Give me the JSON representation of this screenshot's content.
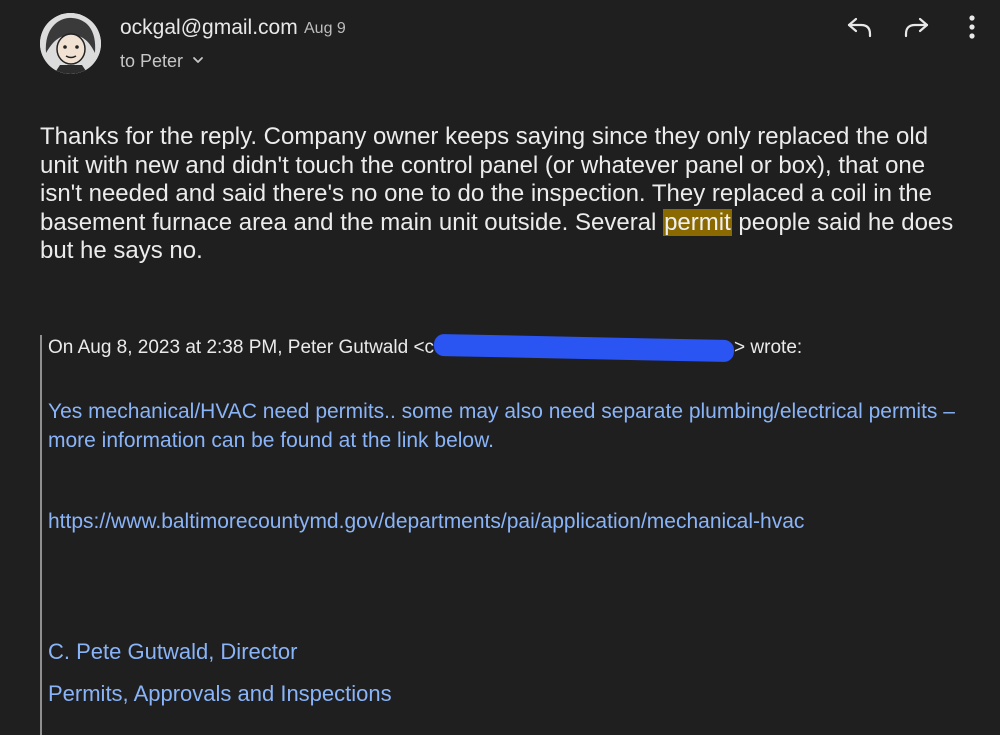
{
  "header": {
    "sender": "ockgal@gmail.com",
    "date": "Aug 9",
    "to_label": "to Peter",
    "icons": [
      "reply-icon",
      "forward-icon",
      "more-vert-icon",
      "chevron-down-icon"
    ]
  },
  "message": {
    "text_before": "Thanks for the reply. Company owner keeps saying since they only replaced the old unit with new and didn't touch the control panel (or whatever panel or box), that one isn't needed and said there's no one to do the inspection. They replaced a coil in the basement furnace area and the main unit outside. Several ",
    "highlight": "permit",
    "text_after": " people said he does but he says no."
  },
  "quote": {
    "header_prefix": "On Aug 8, 2023 at 2:38 PM, Peter Gutwald <",
    "header_partial": "c",
    "header_suffix": "> wrote:",
    "text": "Yes mechanical/HVAC need permits.. some may also need separate plumbing/electrical permits – more information can be found at the link below.",
    "link": "https://www.baltimorecountymd.gov/departments/pai/application/mechanical-hvac",
    "signature_name": "C. Pete Gutwald, Director",
    "signature_dept": "Permits, Approvals and Inspections"
  },
  "colors": {
    "background": "#1f1f1f",
    "quote_text": "#8ab4f8",
    "highlight": "#8a6a00",
    "redaction": "#2b55f2"
  }
}
